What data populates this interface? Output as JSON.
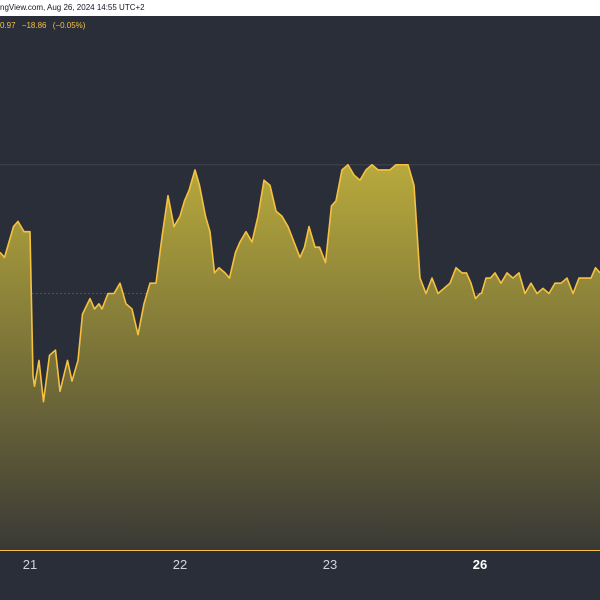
{
  "header": {
    "caption": "ngView.com, Aug 26, 2024 14:55 UTC+2"
  },
  "quote": {
    "partial_price": "0.97",
    "change": "−18.86",
    "change_pct": "(−0.05%)"
  },
  "colors": {
    "background": "#2a2e39",
    "line": "#f6c141",
    "fill_top": "#c4b43c",
    "fill_bottom": "#3a3a35",
    "grid": "#545454",
    "accent": "#f6c141"
  },
  "chart_data": {
    "type": "area",
    "title": "",
    "xlabel": "",
    "ylabel": "",
    "x_ticks": [
      "21",
      "22",
      "23",
      "26"
    ],
    "x_tick_positions": [
      0.2,
      1.2,
      2.2,
      3.2
    ],
    "highlighted_tick": "26",
    "xlim": [
      0,
      4
    ],
    "ylim": [
      0,
      1
    ],
    "grid": true,
    "series": [
      {
        "x": [
          0.0,
          0.03,
          0.06,
          0.09,
          0.12,
          0.16,
          0.2,
          0.22,
          0.23,
          0.26,
          0.29,
          0.33,
          0.37,
          0.4,
          0.45,
          0.48,
          0.52,
          0.55,
          0.6,
          0.63,
          0.66,
          0.68,
          0.72,
          0.76,
          0.8,
          0.84,
          0.88,
          0.92,
          0.96,
          1.0,
          1.04,
          1.08,
          1.12,
          1.16,
          1.2,
          1.23,
          1.26,
          1.3,
          1.33,
          1.37,
          1.4,
          1.43,
          1.46,
          1.5,
          1.53,
          1.57,
          1.6,
          1.64,
          1.68,
          1.72,
          1.76,
          1.8,
          1.84,
          1.88,
          1.92,
          1.96,
          2.0,
          2.03,
          2.06,
          2.1,
          2.13,
          2.17,
          2.21,
          2.24,
          2.28,
          2.32,
          2.36,
          2.4,
          2.44,
          2.48,
          2.52,
          2.56,
          2.6,
          2.64,
          2.68,
          2.72,
          2.76,
          2.8,
          2.84,
          2.88,
          2.92,
          2.96,
          3.0,
          3.04,
          3.08,
          3.11,
          3.14,
          3.17,
          3.2,
          3.21,
          3.24,
          3.27,
          3.3,
          3.34,
          3.38,
          3.42,
          3.46,
          3.5,
          3.54,
          3.58,
          3.62,
          3.66,
          3.7,
          3.74,
          3.78,
          3.82,
          3.86,
          3.9,
          3.94,
          3.97,
          4.0
        ],
        "y": [
          0.58,
          0.57,
          0.6,
          0.63,
          0.64,
          0.62,
          0.62,
          0.34,
          0.32,
          0.37,
          0.29,
          0.38,
          0.39,
          0.31,
          0.37,
          0.33,
          0.37,
          0.46,
          0.49,
          0.47,
          0.48,
          0.47,
          0.5,
          0.5,
          0.52,
          0.48,
          0.47,
          0.42,
          0.48,
          0.52,
          0.52,
          0.61,
          0.69,
          0.63,
          0.65,
          0.68,
          0.7,
          0.74,
          0.71,
          0.65,
          0.62,
          0.54,
          0.55,
          0.54,
          0.53,
          0.58,
          0.6,
          0.62,
          0.6,
          0.65,
          0.72,
          0.71,
          0.66,
          0.65,
          0.63,
          0.6,
          0.57,
          0.59,
          0.63,
          0.59,
          0.59,
          0.56,
          0.67,
          0.68,
          0.74,
          0.75,
          0.73,
          0.72,
          0.74,
          0.75,
          0.74,
          0.74,
          0.74,
          0.75,
          0.75,
          0.75,
          0.71,
          0.53,
          0.5,
          0.53,
          0.5,
          0.51,
          0.52,
          0.55,
          0.54,
          0.54,
          0.52,
          0.49,
          0.5,
          0.5,
          0.53,
          0.53,
          0.54,
          0.52,
          0.54,
          0.53,
          0.54,
          0.5,
          0.52,
          0.5,
          0.51,
          0.5,
          0.52,
          0.52,
          0.53,
          0.5,
          0.53,
          0.53,
          0.53,
          0.55,
          0.54
        ]
      }
    ]
  }
}
